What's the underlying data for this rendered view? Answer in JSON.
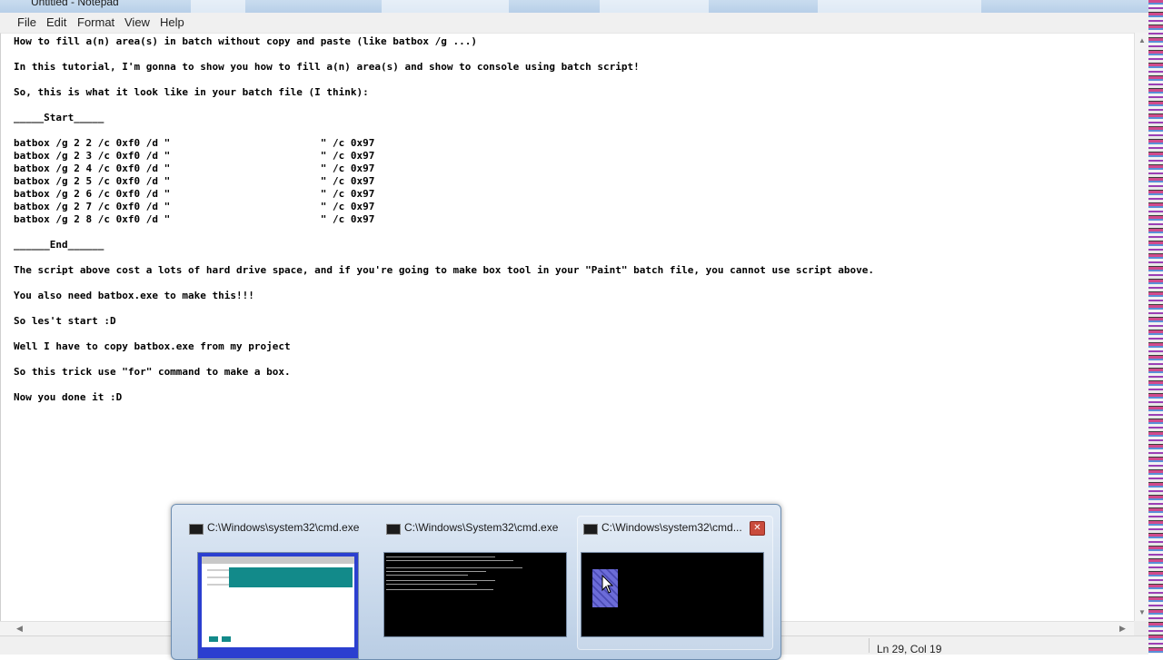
{
  "window": {
    "title": "Untitled - Notepad"
  },
  "menu": {
    "file": "File",
    "edit": "Edit",
    "format": "Format",
    "view": "View",
    "help": "Help"
  },
  "editor_text": "How to fill a(n) area(s) in batch without copy and paste (like batbox /g ...)\n\nIn this tutorial, I'm gonna to show you how to fill a(n) area(s) and show to console using batch script!\n\nSo, this is what it look like in your batch file (I think):\n\n_____Start_____\n\nbatbox /g 2 2 /c 0xf0 /d \"                         \" /c 0x97\nbatbox /g 2 3 /c 0xf0 /d \"                         \" /c 0x97\nbatbox /g 2 4 /c 0xf0 /d \"                         \" /c 0x97\nbatbox /g 2 5 /c 0xf0 /d \"                         \" /c 0x97\nbatbox /g 2 6 /c 0xf0 /d \"                         \" /c 0x97\nbatbox /g 2 7 /c 0xf0 /d \"                         \" /c 0x97\nbatbox /g 2 8 /c 0xf0 /d \"                         \" /c 0x97\n\n______End______\n\nThe script above cost a lots of hard drive space, and if you're going to make box tool in your \"Paint\" batch file, you cannot use script above.\n\nYou also need batbox.exe to make this!!!\n\nSo les't start :D\n\nWell I have to copy batbox.exe from my project\n\nSo this trick use \"for\" command to make a box.\n\nNow you done it :D",
  "status": {
    "position": "Ln 29, Col 19"
  },
  "taskbar_preview": {
    "thumbnails": [
      {
        "title": "C:\\Windows\\system32\\cmd.exe"
      },
      {
        "title": "C:\\Windows\\System32\\cmd.exe"
      },
      {
        "title": "C:\\Windows\\system32\\cmd..."
      }
    ],
    "close_symbol": "✕"
  },
  "colors": {
    "accent_blue": "#2b3fd0",
    "teal": "#128a8a",
    "console_bg": "#000000",
    "selection_box": "#6c6cd8"
  }
}
